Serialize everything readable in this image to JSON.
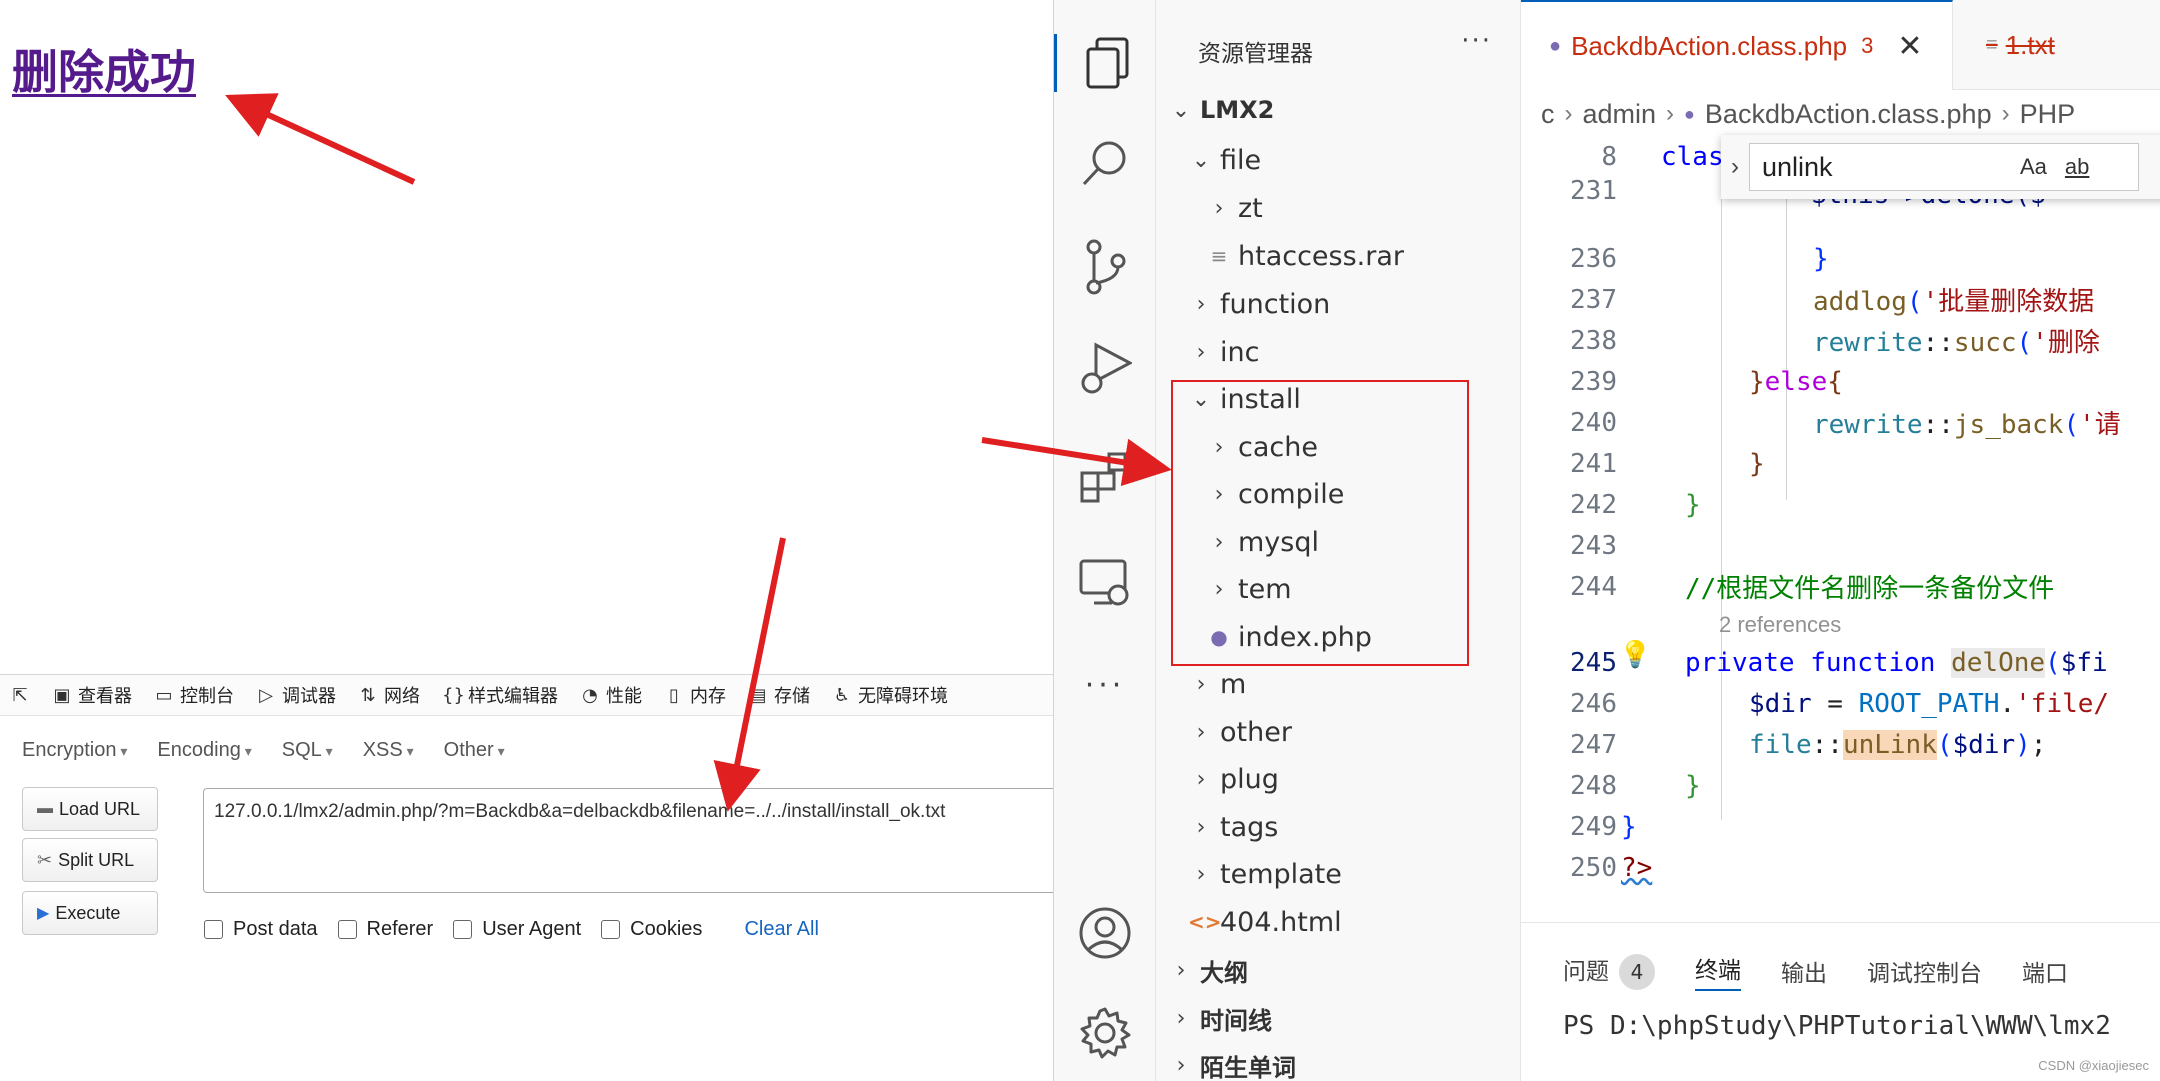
{
  "browser": {
    "success_link": "删除成功",
    "devtools_tabs": [
      "查看器",
      "控制台",
      "调试器",
      "网络",
      "样式编辑器",
      "性能",
      "内存",
      "存储",
      "无障碍环境"
    ],
    "hackbar": {
      "menus": [
        "Encryption",
        "Encoding",
        "SQL",
        "XSS",
        "Other"
      ],
      "buttons": {
        "load_url": "Load URL",
        "split_url": "Split URL",
        "execute": "Execute"
      },
      "url_value": "127.0.0.1/lmx2/admin.php/?m=Backdb&a=delbackdb&filename=../../install/install_ok.txt",
      "options": {
        "post_data": "Post data",
        "referer": "Referer",
        "user_agent": "User Agent",
        "cookies": "Cookies"
      },
      "clear_all": "Clear All"
    }
  },
  "vscode": {
    "explorer": {
      "title": "资源管理器",
      "more": "···",
      "root": "LMX2",
      "items": {
        "file": "file",
        "zt": "zt",
        "htaccess": "htaccess.rar",
        "function": "function",
        "inc": "inc",
        "install": "install",
        "cache": "cache",
        "compile": "compile",
        "mysql": "mysql",
        "tem": "tem",
        "index_php": "index.php",
        "m": "m",
        "other": "other",
        "plug": "plug",
        "tags": "tags",
        "template": "template",
        "html404": "404.html"
      },
      "sections": {
        "outline": "大纲",
        "timeline": "时间线",
        "words": "陌生单词"
      }
    },
    "tabs": {
      "active": "BackdbAction.class.php",
      "active_count": "3",
      "second": "1.txt"
    },
    "breadcrumb": {
      "c": "c",
      "admin": "admin",
      "file": "BackdbAction.class.php",
      "lang": "PHP"
    },
    "find": {
      "query": "unlink",
      "aa": "Aa",
      "ab": "ab"
    },
    "code": {
      "ln8": "8",
      "ln231": "231",
      "ln236": "236",
      "ln237": "237",
      "ln238": "238",
      "ln239": "239",
      "ln240": "240",
      "ln241": "241",
      "ln242": "242",
      "ln243": "243",
      "ln244": "244",
      "ln245": "245",
      "ln246": "246",
      "ln247": "247",
      "ln248": "248",
      "ln249": "249",
      "ln250": "250",
      "t8": "clas",
      "t235": "$this->delOne($",
      "t237_fn": "addlog",
      "t237_str": "'批量删除数据",
      "t238_cls": "rewrite",
      "t238_fn": "succ",
      "t238_str": "'删除",
      "t239_else": "else",
      "t240_cls": "rewrite",
      "t240_fn": "js_back",
      "t240_str": "'请",
      "t244": "//根据文件名删除一条备份文件",
      "codelens": "2 references",
      "t245_priv": "private",
      "t245_func": "function",
      "t245_name": "delOne",
      "t245_var": "$fi",
      "t246_var": "$dir",
      "t246_const": "ROOT_PATH",
      "t246_str": "'file/",
      "t247_cls": "file",
      "t247_fn": "unLink",
      "t247_var": "$dir",
      "t250": "?>"
    },
    "panel": {
      "tabs": {
        "problems": "问题",
        "terminal": "终端",
        "output": "输出",
        "debug": "调试控制台",
        "ports": "端口"
      },
      "problems_count": "4",
      "terminal_text": "PS D:\\phpStudy\\PHPTutorial\\WWW\\lmx2"
    },
    "watermark": "CSDN @xiaojiesec"
  },
  "colors": {
    "annotation_red": "#e02020",
    "accent": "#005fb8"
  }
}
